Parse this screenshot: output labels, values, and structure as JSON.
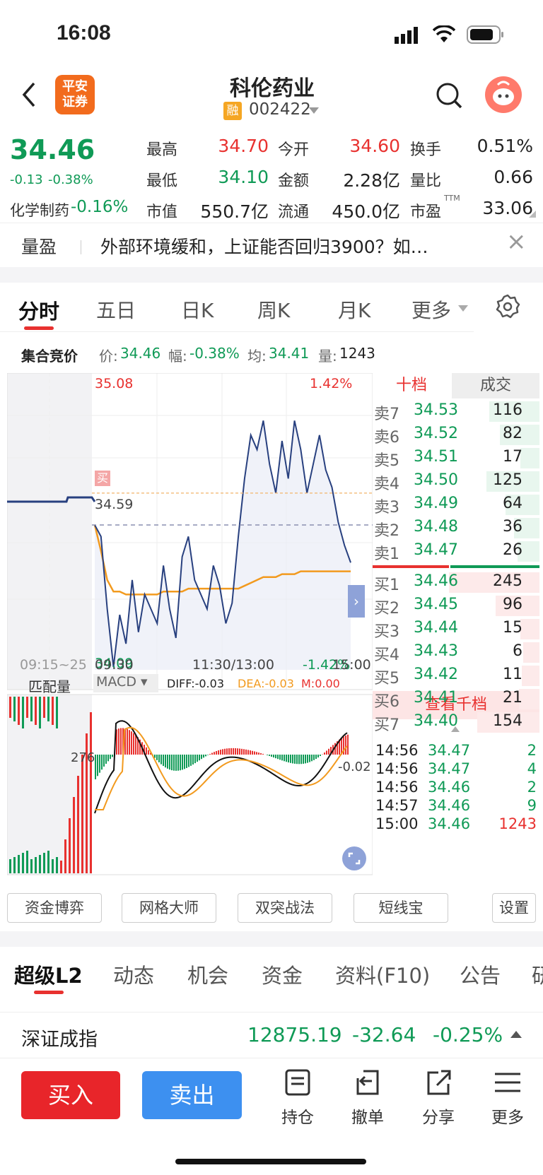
{
  "status": {
    "time": "16:08"
  },
  "header": {
    "logo": "平安\n证券",
    "stock_name": "科伦药业",
    "rong": "融",
    "code": "002422"
  },
  "summary": {
    "price": "34.46",
    "change": "-0.13",
    "change_pct": "-0.38%",
    "sector_name": "化学制药",
    "sector_pct": "-0.16%",
    "high_l": "最高",
    "high": "34.70",
    "open_l": "今开",
    "open": "34.60",
    "turn_l": "换手",
    "turn": "0.51%",
    "low_l": "最低",
    "low": "34.10",
    "amt_l": "金额",
    "amt": "2.28亿",
    "vr_l": "量比",
    "vr": "0.66",
    "mcap_l": "市值",
    "mcap": "550.7亿",
    "float_l": "流通",
    "float": "450.0亿",
    "pe_l": "市盈",
    "pe_sup": "TTM",
    "pe": "33.06"
  },
  "news": {
    "tag": "量盈",
    "text": "外部环境缓和，上证能否回归3900？如…",
    "close": "×"
  },
  "tabs": [
    "分时",
    "五日",
    "日K",
    "周K",
    "月K",
    "更多"
  ],
  "quote_bar": {
    "label": "集合竞价",
    "price_l": "价:",
    "price": "34.46",
    "amp_l": "幅:",
    "amp": "-0.38%",
    "avg_l": "均:",
    "avg": "34.41",
    "vol_l": "量:",
    "vol": "1243"
  },
  "chart": {
    "y_top": "35.08",
    "pct_top": "1.42%",
    "y_bottom": "34.09",
    "pct_bottom": "-1.42%",
    "prev_close": "34.59",
    "buy_tag": "买",
    "x_labels": [
      "09:15~25",
      "09:30",
      "11:30/13:00",
      "15:00"
    ],
    "sub_left": "匹配量",
    "sub_ind": "MACD",
    "diff": "DIFF:-0.03",
    "dea": "DEA:-0.03",
    "m": "M:0.00",
    "sub_left_val": "276",
    "sub_right_val": "-0.02"
  },
  "chart_data": {
    "type": "line",
    "ylim": [
      34.09,
      35.08
    ],
    "prev_close": 34.59,
    "price": [
      34.59,
      34.55,
      34.3,
      34.1,
      34.28,
      34.18,
      34.4,
      34.22,
      34.35,
      34.3,
      34.25,
      34.45,
      34.3,
      34.2,
      34.48,
      34.55,
      34.4,
      34.35,
      34.3,
      34.45,
      34.38,
      34.25,
      34.32,
      34.55,
      34.75,
      34.9,
      34.85,
      34.95,
      34.8,
      34.7,
      34.88,
      34.75,
      34.95,
      34.85,
      34.7,
      34.8,
      34.9,
      34.78,
      34.72,
      34.6,
      34.52,
      34.46
    ],
    "avg": [
      34.59,
      34.5,
      34.4,
      34.36,
      34.36,
      34.35,
      34.35,
      34.35,
      34.35,
      34.35,
      34.35,
      34.36,
      34.36,
      34.36,
      34.36,
      34.37,
      34.37,
      34.37,
      34.37,
      34.37,
      34.37,
      34.37,
      34.37,
      34.37,
      34.38,
      34.39,
      34.4,
      34.41,
      34.41,
      34.41,
      34.42,
      34.42,
      34.42,
      34.43,
      34.43,
      34.43,
      34.43,
      34.43,
      34.43,
      34.43,
      34.43,
      34.43
    ]
  },
  "book": {
    "tab_left": "十档",
    "tab_right": "成交",
    "asks": [
      [
        "卖7",
        "34.53",
        "116"
      ],
      [
        "卖6",
        "34.52",
        "82"
      ],
      [
        "卖5",
        "34.51",
        "17"
      ],
      [
        "卖4",
        "34.50",
        "125"
      ],
      [
        "卖3",
        "34.49",
        "64"
      ],
      [
        "卖2",
        "34.48",
        "36"
      ],
      [
        "卖1",
        "34.47",
        "26"
      ]
    ],
    "bids": [
      [
        "买1",
        "34.46",
        "245"
      ],
      [
        "买2",
        "34.45",
        "96"
      ],
      [
        "买3",
        "34.44",
        "15"
      ],
      [
        "买4",
        "34.43",
        "6"
      ],
      [
        "买5",
        "34.42",
        "11"
      ],
      [
        "买6",
        "34.41",
        "21"
      ],
      [
        "买7",
        "34.40",
        "154"
      ]
    ],
    "more": "查看千档",
    "trades": [
      [
        "14:56",
        "34.47",
        "2"
      ],
      [
        "14:56",
        "34.47",
        "4"
      ],
      [
        "14:56",
        "34.46",
        "2"
      ],
      [
        "14:57",
        "34.46",
        "9"
      ],
      [
        "15:00",
        "34.46",
        "1243"
      ]
    ]
  },
  "tools": [
    "资金博弈",
    "网格大师",
    "双突战法",
    "短线宝",
    "设置"
  ],
  "tabs2": [
    "超级L2",
    "动态",
    "机会",
    "资金",
    "资料(F10)",
    "公告",
    "研"
  ],
  "index": {
    "name": "深证成指",
    "value": "12875.19",
    "change": "-32.64",
    "pct": "-0.25%"
  },
  "bottom": {
    "buy": "买入",
    "sell": "卖出",
    "hold": "持仓",
    "cancel": "撤单",
    "share": "分享",
    "more": "更多"
  }
}
